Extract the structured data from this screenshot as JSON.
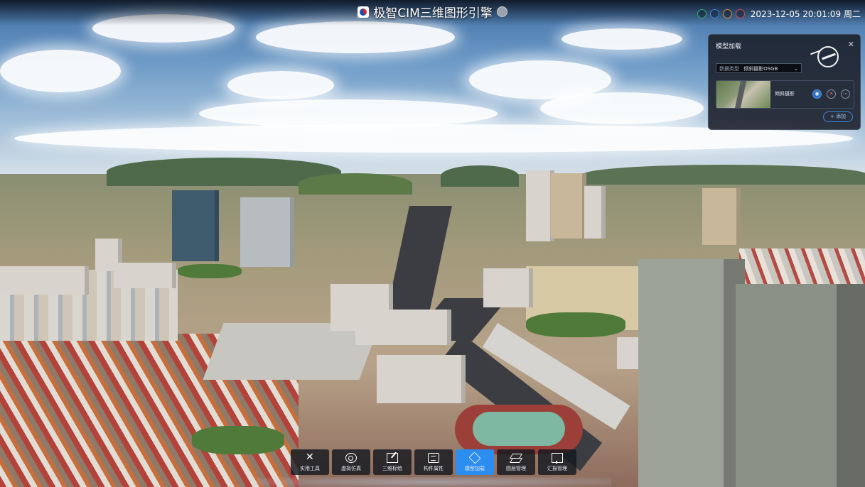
{
  "app": {
    "title": "极智CIM三维图形引擎"
  },
  "status_bar": {
    "icons": [
      "shield-icon",
      "save-icon",
      "home-icon",
      "trash-icon"
    ],
    "icon_colors": [
      "#2bb673",
      "#3a8ee6",
      "#e58a3a",
      "#e04848"
    ],
    "datetime": "2023-12-05 20:01:09 周二"
  },
  "model_panel": {
    "title": "模型加载",
    "close_label": "✕",
    "data_type_label": "数据类型",
    "data_type_value": "倾斜摄影OSGB",
    "models": [
      {
        "name": "倾斜摄影"
      }
    ],
    "add_label": "+ 添加"
  },
  "toolbar": {
    "items": [
      {
        "label": "实用工具",
        "icon": "tools-icon",
        "active": false
      },
      {
        "label": "虚拟仿真",
        "icon": "simulation-icon",
        "active": false
      },
      {
        "label": "三维标绘",
        "icon": "plot-icon",
        "active": false
      },
      {
        "label": "构件属性",
        "icon": "attribute-icon",
        "active": false
      },
      {
        "label": "模型加载",
        "icon": "model-icon",
        "active": true
      },
      {
        "label": "图层管理",
        "icon": "layers-icon",
        "active": false
      },
      {
        "label": "汇报管理",
        "icon": "report-icon",
        "active": false
      }
    ],
    "accent": "#2b8df0"
  }
}
